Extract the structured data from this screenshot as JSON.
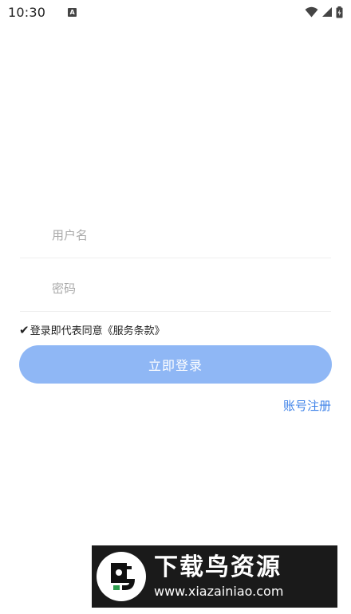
{
  "status_bar": {
    "time": "10:30",
    "notification_badge": "A"
  },
  "form": {
    "username_placeholder": "用户名",
    "password_placeholder": "密码",
    "agreement_check": "✔",
    "agreement_text": "登录即代表同意《服务条款》",
    "login_label": "立即登录",
    "register_label": "账号注册"
  },
  "watermark": {
    "title": "下载鸟资源",
    "url": "www.xiazainiao.com"
  },
  "colors": {
    "primary_button": "#8fb7f5",
    "link": "#3e82e8"
  }
}
